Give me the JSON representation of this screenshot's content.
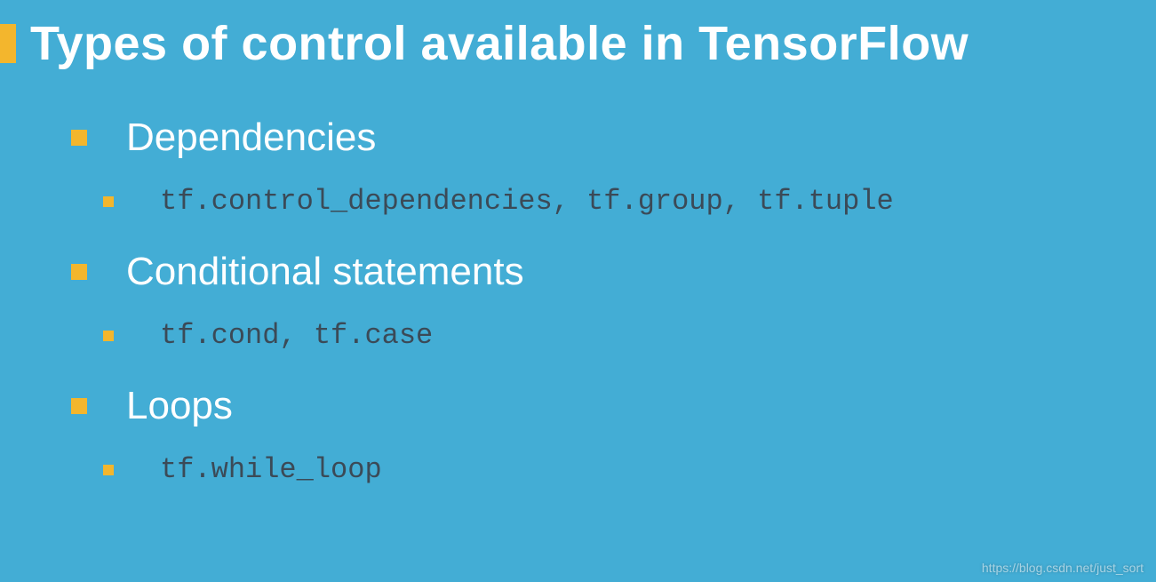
{
  "title": "Types of control available in TensorFlow",
  "sections": [
    {
      "heading": "Dependencies",
      "code": "tf.control_dependencies, tf.group, tf.tuple"
    },
    {
      "heading": "Conditional statements",
      "code": "tf.cond, tf.case"
    },
    {
      "heading": "Loops",
      "code": "tf.while_loop"
    }
  ],
  "watermark": "https://blog.csdn.net/just_sort"
}
